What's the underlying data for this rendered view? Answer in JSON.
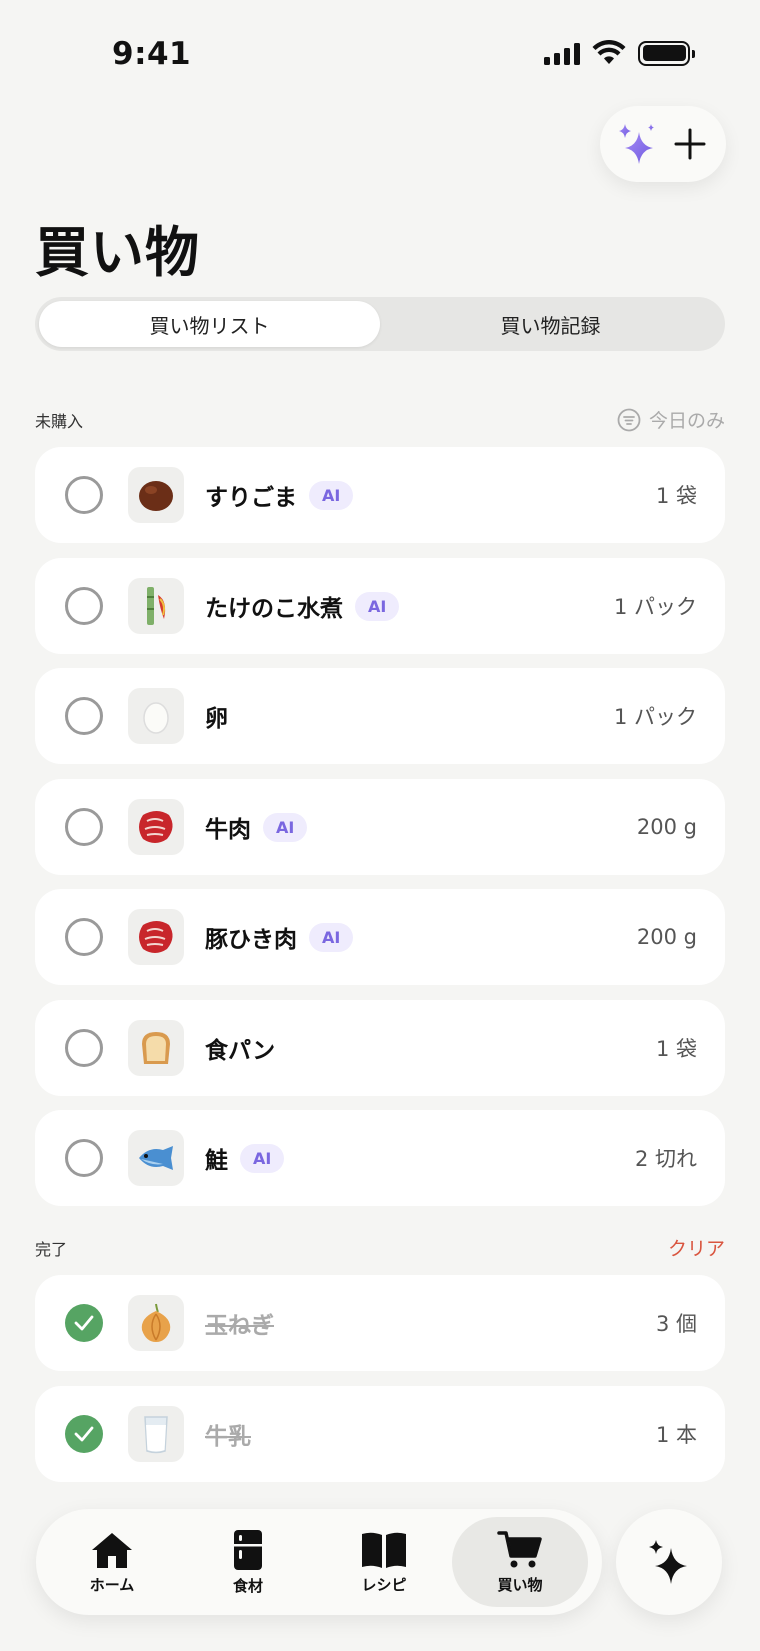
{
  "status_bar": {
    "time": "9:41"
  },
  "header": {
    "title": "買い物"
  },
  "segments": [
    {
      "label": "買い物リスト",
      "active": true
    },
    {
      "label": "買い物記録",
      "active": false
    }
  ],
  "pending": {
    "label": "未購入",
    "filter_label": "今日のみ",
    "items": [
      {
        "name": "すりごま",
        "ai": true,
        "qty": "1 袋",
        "icon": "sesame-icon"
      },
      {
        "name": "たけのこ水煮",
        "ai": true,
        "qty": "1 パック",
        "icon": "bamboo-icon"
      },
      {
        "name": "卵",
        "ai": false,
        "qty": "1 パック",
        "icon": "egg-icon"
      },
      {
        "name": "牛肉",
        "ai": true,
        "qty": "200 g",
        "icon": "meat-icon"
      },
      {
        "name": "豚ひき肉",
        "ai": true,
        "qty": "200 g",
        "icon": "meat-icon"
      },
      {
        "name": "食パン",
        "ai": false,
        "qty": "1 袋",
        "icon": "bread-icon"
      },
      {
        "name": "鮭",
        "ai": true,
        "qty": "2 切れ",
        "icon": "fish-icon"
      }
    ]
  },
  "done": {
    "label": "完了",
    "clear_label": "クリア",
    "items": [
      {
        "name": "玉ねぎ",
        "qty": "3 個",
        "icon": "onion-icon"
      },
      {
        "name": "牛乳",
        "qty": "1 本",
        "icon": "milk-icon"
      }
    ]
  },
  "ai_badge": "AI",
  "tabbar": {
    "tabs": [
      {
        "label": "ホーム",
        "icon": "home-icon"
      },
      {
        "label": "食材",
        "icon": "fridge-icon"
      },
      {
        "label": "レシピ",
        "icon": "book-icon"
      },
      {
        "label": "買い物",
        "icon": "cart-icon",
        "active": true
      }
    ]
  },
  "colors": {
    "accent_ai": "#7a67e0",
    "check_done": "#56a463",
    "clear": "#d9553f"
  }
}
